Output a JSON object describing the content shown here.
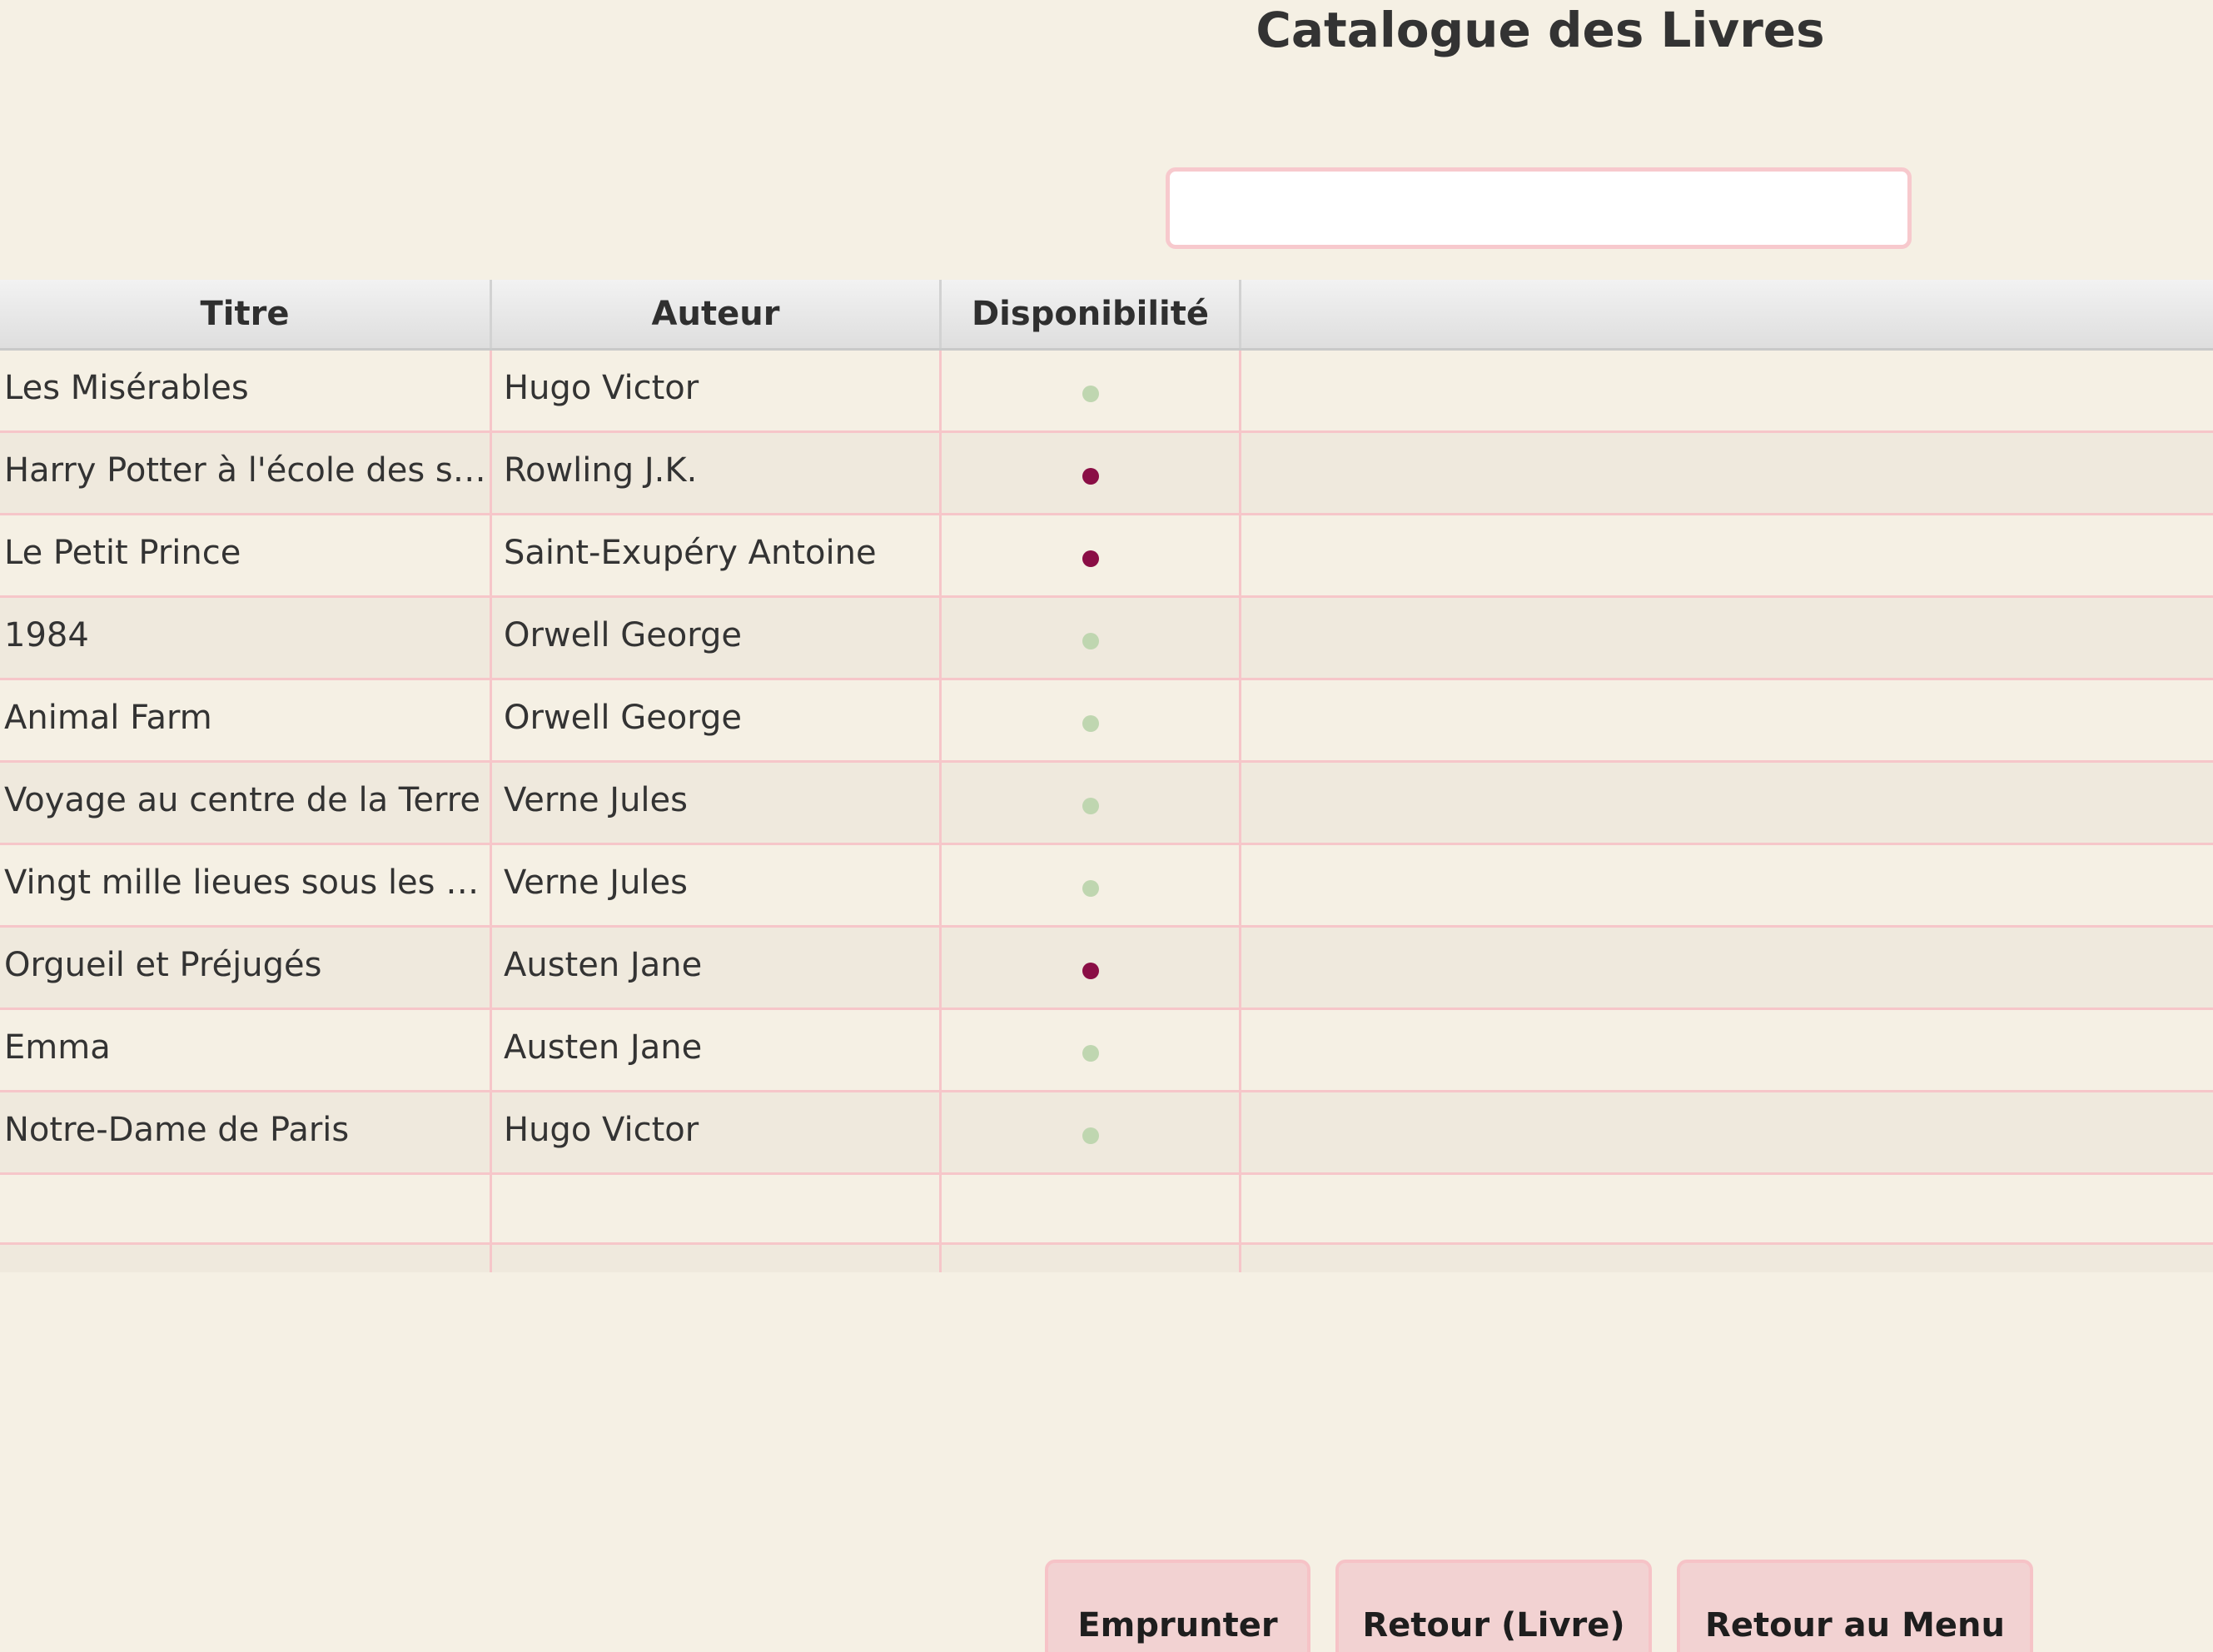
{
  "header": {
    "title": "Catalogue des Livres"
  },
  "search": {
    "value": "",
    "placeholder": ""
  },
  "table": {
    "columns": [
      "Titre",
      "Auteur",
      "Disponibilité"
    ],
    "rows": [
      {
        "title": "Les Misérables",
        "author": "Hugo Victor",
        "available": true
      },
      {
        "title": "Harry Potter à l'école des sor...",
        "author": "Rowling J.K.",
        "available": false
      },
      {
        "title": "Le Petit Prince",
        "author": "Saint-Exupéry Antoine",
        "available": false
      },
      {
        "title": "1984",
        "author": "Orwell George",
        "available": true
      },
      {
        "title": "Animal Farm",
        "author": "Orwell George",
        "available": true
      },
      {
        "title": "Voyage au centre de la Terre",
        "author": "Verne Jules",
        "available": true
      },
      {
        "title": "Vingt mille lieues sous les mers",
        "author": "Verne Jules",
        "available": true
      },
      {
        "title": "Orgueil et Préjugés",
        "author": "Austen Jane",
        "available": false
      },
      {
        "title": "Emma",
        "author": "Austen Jane",
        "available": true
      },
      {
        "title": "Notre-Dame de Paris",
        "author": "Hugo Victor",
        "available": true
      }
    ]
  },
  "colors": {
    "available": "#bfd6b0",
    "unavailable": "#8a0e45",
    "accent_border": "#f6c6c9",
    "button_bg": "#f2d2d2"
  },
  "buttons": {
    "borrow": "Emprunter",
    "return_book": "Retour (Livre)",
    "back_menu": "Retour au Menu"
  }
}
